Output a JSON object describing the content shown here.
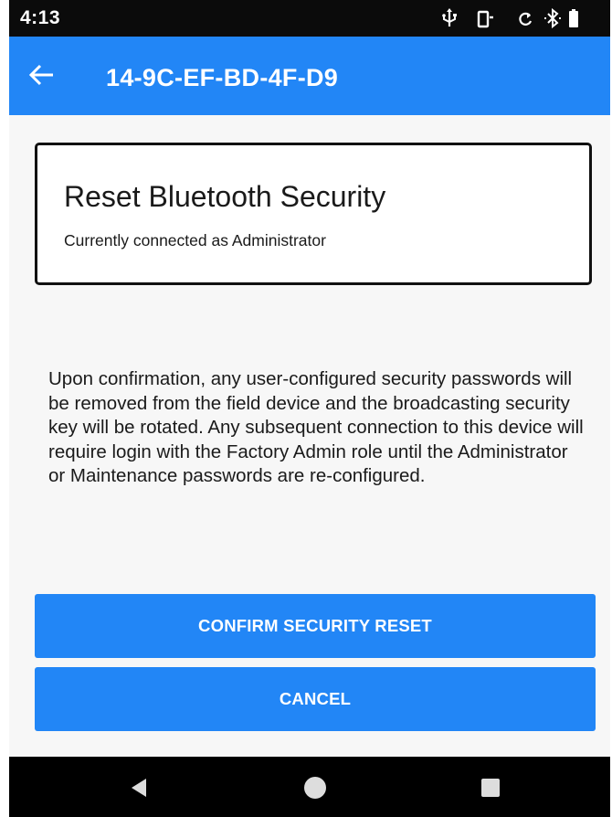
{
  "status_bar": {
    "time": "4:13",
    "icons": [
      "usb-icon",
      "cast-icon",
      "sync-icon",
      "bluetooth-icon",
      "battery-icon"
    ]
  },
  "app_bar": {
    "title": "14-9C-EF-BD-4F-D9",
    "back_icon": "arrow-left-icon",
    "color": "#2286f6"
  },
  "card": {
    "title": "Reset Bluetooth Security",
    "subtitle": "Currently connected as Administrator"
  },
  "description": "Upon confirmation, any user-configured security passwords will be removed from the field device and the broadcasting security key will be rotated. Any subsequent connection to this device will require login with the Factory Admin role until the Administrator or Maintenance passwords are re-configured.",
  "buttons": {
    "confirm_label": "CONFIRM SECURITY RESET",
    "cancel_label": "CANCEL"
  },
  "nav_bar": {
    "icons": [
      "nav-back-icon",
      "nav-home-icon",
      "nav-recents-icon"
    ]
  }
}
